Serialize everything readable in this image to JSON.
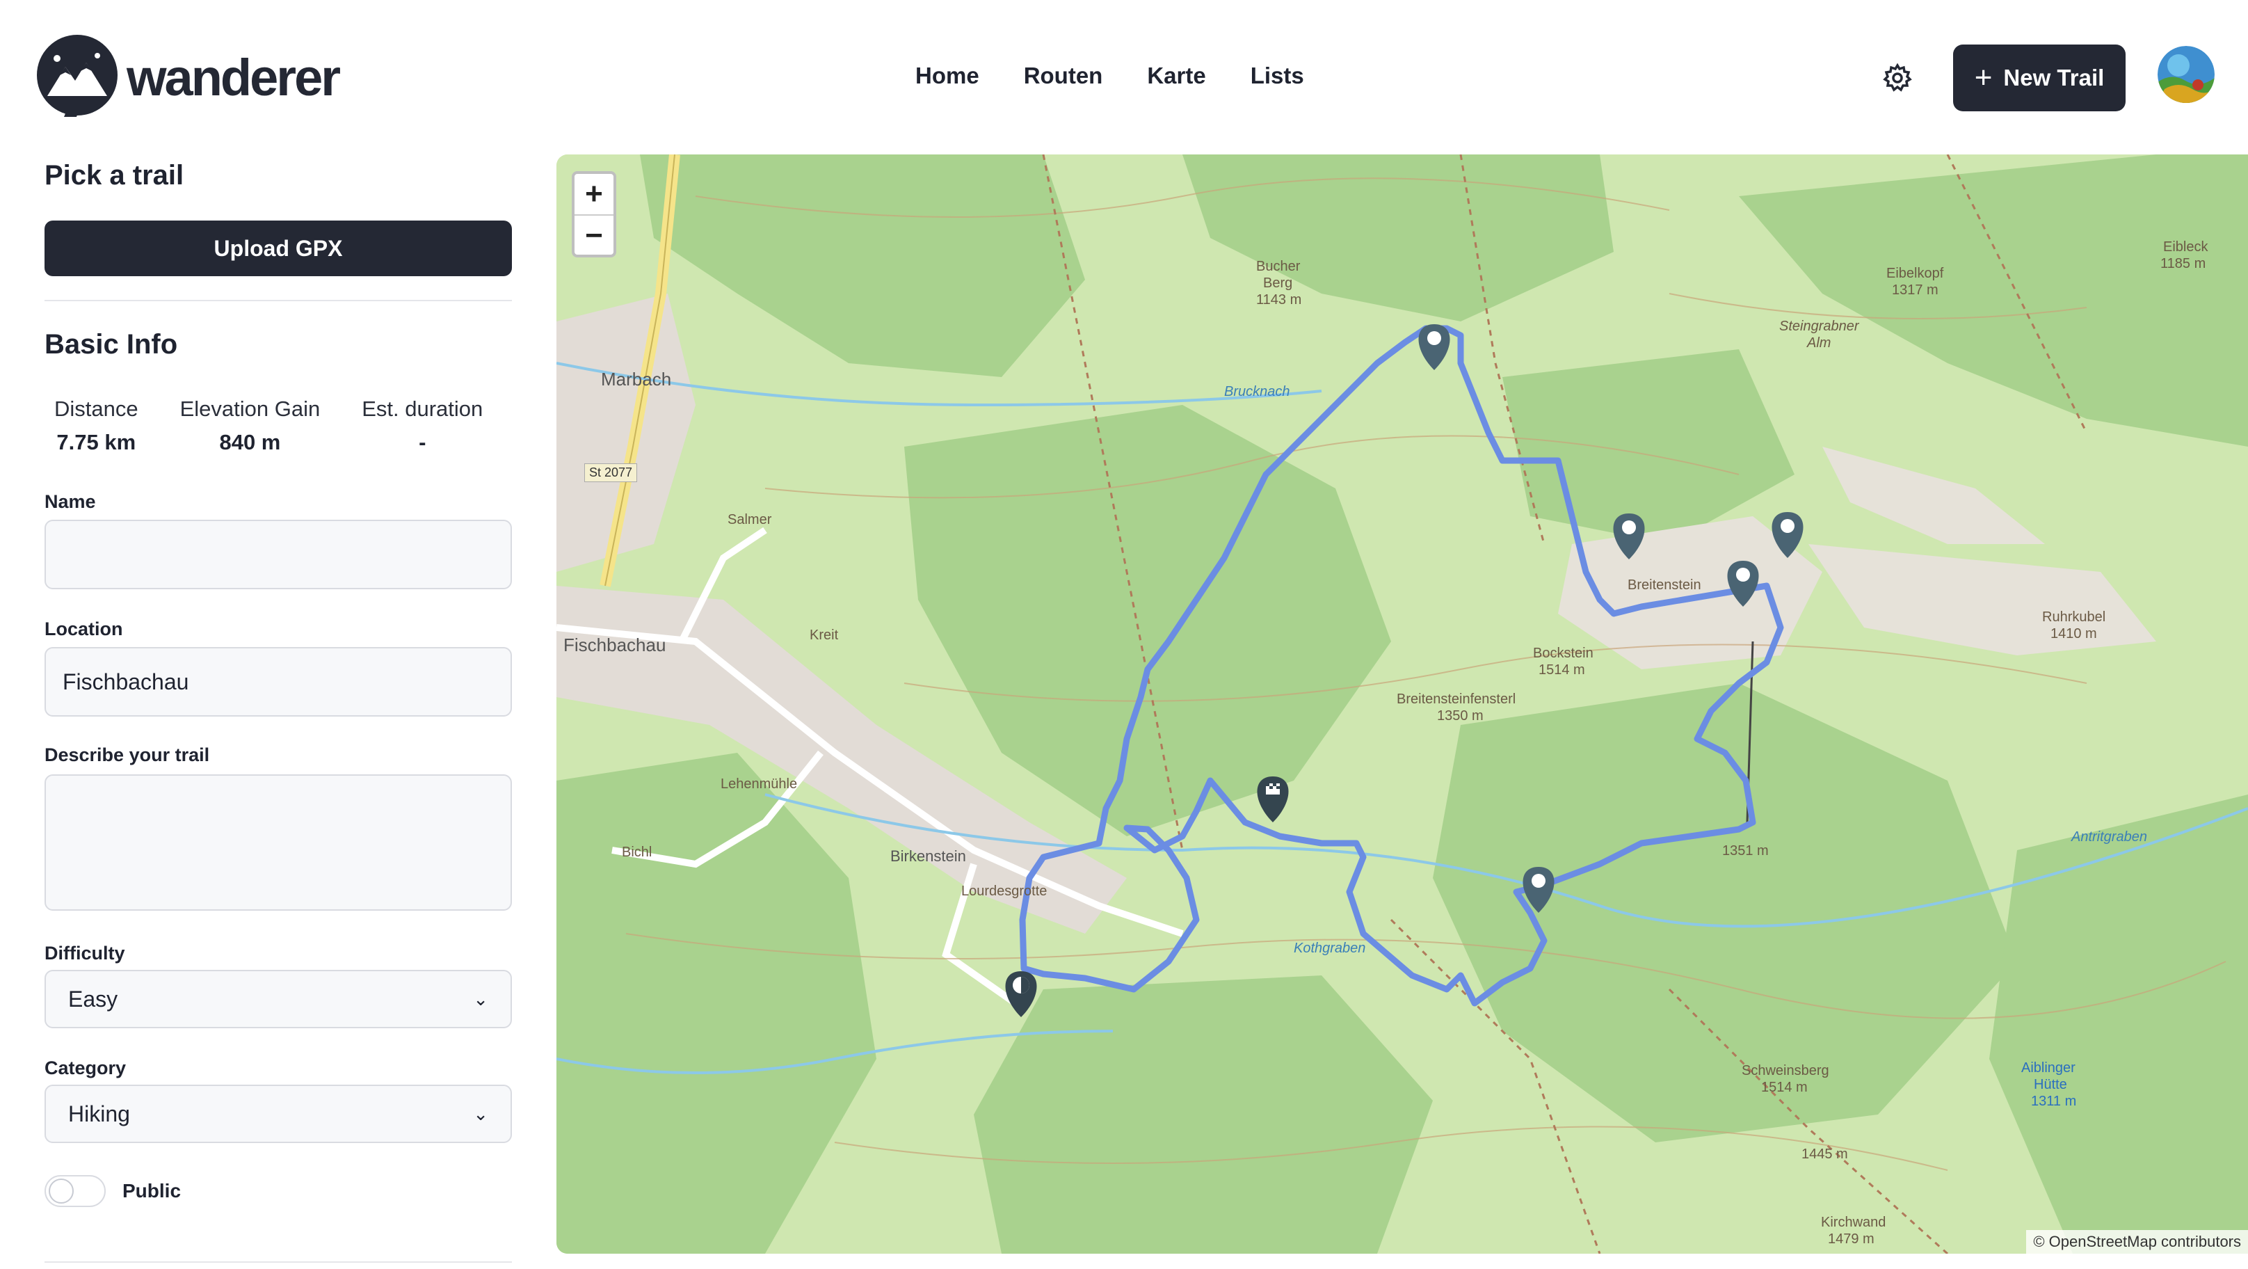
{
  "brand": {
    "name": "wanderer"
  },
  "nav": {
    "items": [
      "Home",
      "Routen",
      "Karte",
      "Lists"
    ]
  },
  "header": {
    "new_trail_label": "New Trail",
    "new_trail_icon": "plus-icon",
    "settings_icon": "gear-icon"
  },
  "sidebar": {
    "pick_title": "Pick a trail",
    "upload_label": "Upload GPX",
    "basic_info_title": "Basic Info",
    "stats": [
      {
        "label": "Distance",
        "value": "7.75 km"
      },
      {
        "label": "Elevation Gain",
        "value": "840 m"
      },
      {
        "label": "Est. duration",
        "value": "-"
      }
    ],
    "name_label": "Name",
    "name_value": "",
    "location_label": "Location",
    "location_value": "Fischbachau",
    "description_label": "Describe your trail",
    "description_value": "",
    "difficulty_label": "Difficulty",
    "difficulty_value": "Easy",
    "category_label": "Category",
    "category_value": "Hiking",
    "public_label": "Public",
    "public_enabled": false
  },
  "map": {
    "zoom_in": "+",
    "zoom_out": "−",
    "attribution": "© OpenStreetMap contributors",
    "route_color": "#6b8de3",
    "marker_color": "#4a6473",
    "labels": {
      "bucher_berg": "Bucher",
      "bucher_berg2": "Berg",
      "bucher_berg3": "1143 m",
      "eibelkopf": "Eibelkopf",
      "eibelkopf_h": "1317 m",
      "eibleck": "Eibleck",
      "eibleck_h": "1185 m",
      "steingrabner": "Steingrabner",
      "alm": "Alm",
      "marbach": "Marbach",
      "st2077": "St 2077",
      "salmer": "Salmer",
      "kreit": "Kreit",
      "fischbachau": "Fischbachau",
      "lehenmuhle": "Lehenmühle",
      "bichl": "Bichl",
      "birkenstein": "Birkenstein",
      "lourdesgrotte": "Lourdesgrotte",
      "bockstein": "Bockstein",
      "bockstein_h": "1514 m",
      "breitenstein": "Breitenstein",
      "breitensteinfenster": "Breitensteinfensterl",
      "bsf_h": "1350 m",
      "ruhrkubel": "Ruhrkubel",
      "ruhrkubel_h": "1410 m",
      "h1351": "1351 m",
      "schweinsberg": "Schweinsberg",
      "schweinsberg_h": "1514 m",
      "h1445": "1445 m",
      "aiblinger": "Aiblinger",
      "hutte": "Hütte",
      "hutte_h": "1311 m",
      "kirchwand": "Kirchwand",
      "kirchwand_h": "1479 m",
      "kothgraben": "Kothgraben",
      "brucknach": "Brucknach",
      "antritgraben": "Antritgraben"
    }
  }
}
